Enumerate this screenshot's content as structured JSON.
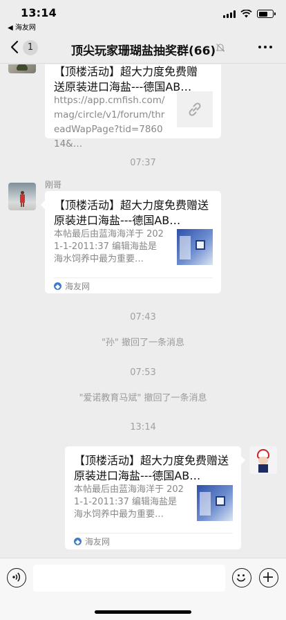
{
  "status": {
    "time": "13:14",
    "back_app": "◀ 海友网",
    "battery_level": 0.62
  },
  "nav": {
    "back_badge": "1",
    "title": "顶尖玩家珊瑚盐抽奖群(66)",
    "icons": [
      "back-chevron-icon",
      "mute-bell-icon",
      "more-dots-icon"
    ]
  },
  "messages": {
    "first_card": {
      "title": "【顶楼活动】超大力度免费赠送原装进口海盐---德国AB…",
      "url": "https://app.cmfish.com/mag/circle/v1/forum/threadWapPage?tid=786014&…",
      "thumb_icon": "link-icon"
    },
    "time_1": "07:37",
    "second": {
      "sender": "刚哥",
      "title": "【顶楼活动】超大力度免费赠送原装进口海盐---德国AB…",
      "desc": "本帖最后由蓝海海洋于 2021-1-2011:37 编辑海盐是海水饲养中最为重要…",
      "source": "海友网"
    },
    "time_2": "07:43",
    "recall_1": "\"孙\" 撤回了一条消息",
    "time_3": "07:53",
    "recall_2": "\"爱诺教育马斌\" 撤回了一条消息",
    "time_4": "13:14",
    "mine": {
      "title": "【顶楼活动】超大力度免费赠送原装进口海盐---德国AB…",
      "desc": "本帖最后由蓝海海洋于 2021-1-2011:37 编辑海盐是海水饲养中最为重要…",
      "source": "海友网"
    }
  },
  "input_bar": {
    "placeholder": "",
    "icons": [
      "voice-icon",
      "emoji-icon",
      "plus-icon"
    ]
  }
}
